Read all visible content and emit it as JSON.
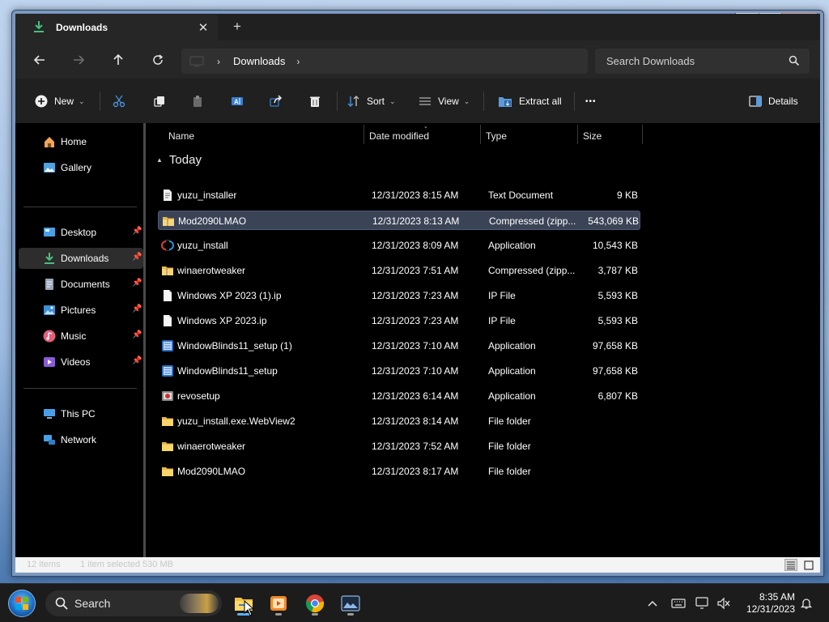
{
  "window": {
    "tab_title": "Downloads",
    "tab_close": "✕",
    "new_tab": "+",
    "controls": {
      "minimize": "—",
      "maximize": "▢",
      "close": "✕"
    }
  },
  "nav": {
    "back_icon": "arrow-left-icon",
    "forward_icon": "arrow-right-icon",
    "up_icon": "arrow-up-icon",
    "refresh_icon": "refresh-icon",
    "breadcrumb": [
      "Downloads"
    ],
    "search_placeholder": "Search Downloads"
  },
  "commands": {
    "new": "New",
    "sort": "Sort",
    "view": "View",
    "extract_all": "Extract all",
    "more": "•••",
    "details": "Details"
  },
  "sidebar": {
    "quick": [
      {
        "label": "Home",
        "icon": "home-icon"
      },
      {
        "label": "Gallery",
        "icon": "gallery-icon"
      }
    ],
    "pinned": [
      {
        "label": "Desktop",
        "icon": "desktop-icon"
      },
      {
        "label": "Downloads",
        "icon": "downloads-icon",
        "selected": true
      },
      {
        "label": "Documents",
        "icon": "documents-icon"
      },
      {
        "label": "Pictures",
        "icon": "pictures-icon"
      },
      {
        "label": "Music",
        "icon": "music-icon"
      },
      {
        "label": "Videos",
        "icon": "videos-icon"
      }
    ],
    "devices": [
      {
        "label": "This PC",
        "icon": "this-pc-icon"
      },
      {
        "label": "Network",
        "icon": "network-icon"
      }
    ]
  },
  "columns": {
    "name": "Name",
    "date": "Date modified",
    "type": "Type",
    "size": "Size"
  },
  "group": {
    "label": "Today"
  },
  "files": [
    {
      "name": "yuzu_installer",
      "date": "12/31/2023 8:15 AM",
      "type": "Text Document",
      "size": "9 KB",
      "icon": "text-file-icon"
    },
    {
      "name": "Mod2090LMAO",
      "date": "12/31/2023 8:13 AM",
      "type": "Compressed (zipp...",
      "size": "543,069 KB",
      "icon": "zip-folder-icon",
      "selected": true
    },
    {
      "name": "yuzu_install",
      "date": "12/31/2023 8:09 AM",
      "type": "Application",
      "size": "10,543 KB",
      "icon": "yuzu-app-icon"
    },
    {
      "name": "winaerotweaker",
      "date": "12/31/2023 7:51 AM",
      "type": "Compressed (zipp...",
      "size": "3,787 KB",
      "icon": "zip-folder-icon"
    },
    {
      "name": "Windows XP 2023 (1).ip",
      "date": "12/31/2023 7:23 AM",
      "type": "IP File",
      "size": "5,593 KB",
      "icon": "blank-file-icon"
    },
    {
      "name": "Windows XP 2023.ip",
      "date": "12/31/2023 7:23 AM",
      "type": "IP File",
      "size": "5,593 KB",
      "icon": "blank-file-icon"
    },
    {
      "name": "WindowBlinds11_setup (1)",
      "date": "12/31/2023 7:10 AM",
      "type": "Application",
      "size": "97,658 KB",
      "icon": "windowblinds-app-icon"
    },
    {
      "name": "WindowBlinds11_setup",
      "date": "12/31/2023 7:10 AM",
      "type": "Application",
      "size": "97,658 KB",
      "icon": "windowblinds-app-icon"
    },
    {
      "name": "revosetup",
      "date": "12/31/2023 6:14 AM",
      "type": "Application",
      "size": "6,807 KB",
      "icon": "revo-app-icon"
    },
    {
      "name": "yuzu_install.exe.WebView2",
      "date": "12/31/2023 8:14 AM",
      "type": "File folder",
      "size": "",
      "icon": "folder-icon"
    },
    {
      "name": "winaerotweaker",
      "date": "12/31/2023 7:52 AM",
      "type": "File folder",
      "size": "",
      "icon": "folder-icon"
    },
    {
      "name": "Mod2090LMAO",
      "date": "12/31/2023 8:17 AM",
      "type": "File folder",
      "size": "",
      "icon": "folder-icon"
    }
  ],
  "status": {
    "items": "12 items",
    "selected": "1 item selected  530 MB"
  },
  "taskbar": {
    "search_label": "Search",
    "apps": [
      {
        "name": "file-explorer-icon",
        "active": true
      },
      {
        "name": "media-player-icon",
        "active": false
      },
      {
        "name": "chrome-icon",
        "active": false
      },
      {
        "name": "photos-icon",
        "active": false
      }
    ],
    "time": "8:35 AM",
    "date": "12/31/2023"
  },
  "colors": {
    "accent": "#5cb3ff",
    "download_green": "#47c07d",
    "selection": "#3b4456",
    "window_frame": "#7d98bd"
  }
}
